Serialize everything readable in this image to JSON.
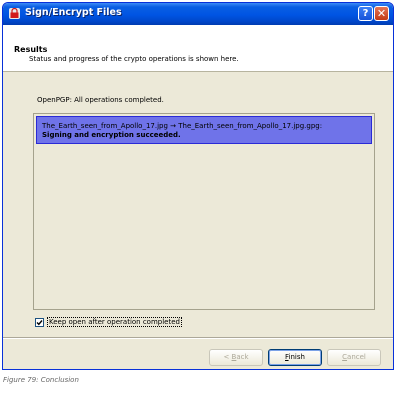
{
  "window": {
    "title": "Sign/Encrypt Files",
    "help_glyph": "?",
    "close_glyph": "✕"
  },
  "header": {
    "title": "Results",
    "subtitle": "Status and progress of the crypto operations is shown here."
  },
  "status": {
    "text": "OpenPGP: All operations completed."
  },
  "results_list": {
    "items": [
      {
        "operation": "The_Earth_seen_from_Apollo_17.jpg → The_Earth_seen_from_Apollo_17.jpg.gpg:",
        "result": "Signing and encryption succeeded."
      }
    ]
  },
  "keep_open": {
    "label": "Keep open after operation completed",
    "checked": true
  },
  "buttons": {
    "back_prefix": "< ",
    "back_accel": "B",
    "back_rest": "ack",
    "finish_accel": "F",
    "finish_rest": "inish",
    "cancel_accel": "C",
    "cancel_rest": "ancel"
  },
  "caption": "Figure 79: Conclusion",
  "colors": {
    "titlebar": "#0054e3",
    "selection": "#6f73e9",
    "dialog_bg": "#ece9d8"
  },
  "icons": [
    "app-lock-icon",
    "help-icon",
    "close-icon",
    "checkmark-icon"
  ]
}
